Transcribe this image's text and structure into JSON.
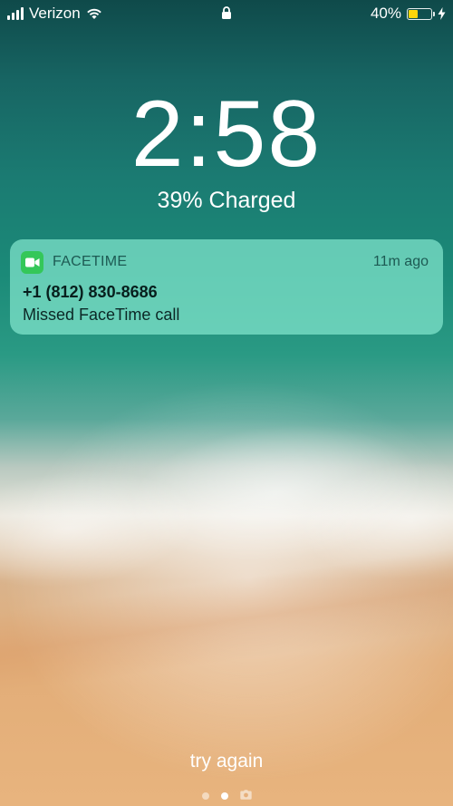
{
  "status_bar": {
    "carrier": "Verizon",
    "battery_percent": "40%",
    "battery_level": 0.4,
    "battery_color": "#ffd60a",
    "icons": [
      "signal-icon",
      "wifi-icon",
      "lock-icon",
      "battery-icon",
      "charging-bolt-icon"
    ]
  },
  "lock_screen": {
    "time": "2:58",
    "charge_status": "39% Charged",
    "hint": "try again"
  },
  "notification": {
    "app_name": "FACETIME",
    "time_ago": "11m ago",
    "title": "+1 (812) 830-8686",
    "body": "Missed FaceTime call",
    "app_icon": "facetime-icon",
    "app_color": "#34c759"
  },
  "pager": {
    "pages": 3,
    "active_index": 1,
    "last_icon": "camera-icon"
  }
}
